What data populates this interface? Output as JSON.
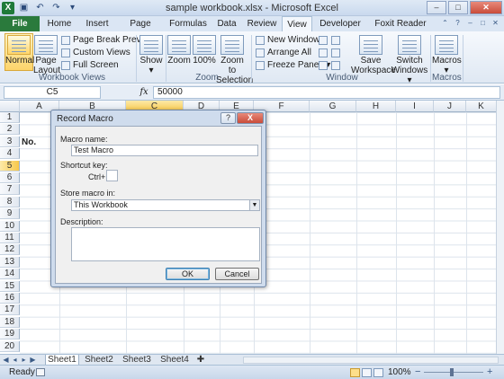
{
  "window": {
    "title": "sample workbook.xlsx - Microsoft Excel",
    "controls": {
      "minimize": "–",
      "maximize": "□",
      "close": "✕"
    },
    "app_icon": "X"
  },
  "ribbon_tabs": [
    "File",
    "Home",
    "Insert",
    "Page Layout",
    "Formulas",
    "Data",
    "Review",
    "View",
    "Developer",
    "Foxit Reader PDF"
  ],
  "active_tab": "View",
  "ribbon": {
    "workbook_views": {
      "label": "Workbook Views",
      "normal": "Normal",
      "page_layout_1": "Page",
      "page_layout_2": "Layout",
      "page_break_preview": "Page Break Preview",
      "custom_views": "Custom Views",
      "full_screen": "Full Screen"
    },
    "show": {
      "label": "Show"
    },
    "zoom": {
      "label": "Zoom",
      "zoom": "Zoom",
      "zoom_100": "100%",
      "zoom_to_selection_1": "Zoom to",
      "zoom_to_selection_2": "Selection"
    },
    "window": {
      "label": "Window",
      "new_window": "New Window",
      "arrange_all": "Arrange All",
      "freeze_panes": "Freeze Panes",
      "save_workspace_1": "Save",
      "save_workspace_2": "Workspace",
      "switch_windows_1": "Switch",
      "switch_windows_2": "Windows"
    },
    "macros": {
      "label": "Macros",
      "macros": "Macros"
    }
  },
  "formula_bar": {
    "name_box": "C5",
    "fx": "fx",
    "value": "50000"
  },
  "grid": {
    "columns": [
      "A",
      "B",
      "C",
      "D",
      "E",
      "F",
      "G",
      "H",
      "I",
      "J",
      "K"
    ],
    "selected_column": "C",
    "rows": [
      "1",
      "2",
      "3",
      "4",
      "5",
      "6",
      "7",
      "8",
      "9",
      "10",
      "11",
      "12",
      "13",
      "14",
      "15",
      "16",
      "17",
      "18",
      "19",
      "20"
    ],
    "selected_row": "5",
    "cell_a3": "No."
  },
  "sheets": [
    "Sheet1",
    "Sheet2",
    "Sheet3",
    "Sheet4"
  ],
  "active_sheet": "Sheet1",
  "status": {
    "ready": "Ready",
    "zoom": "100%",
    "minus": "−",
    "plus": "+"
  },
  "dialog": {
    "title": "Record Macro",
    "help": "?",
    "close": "X",
    "macro_name_label": "Macro name:",
    "macro_name_value": "Test Macro",
    "shortcut_label": "Shortcut key:",
    "ctrl_label": "Ctrl+",
    "shortcut_value": "",
    "store_label": "Store macro in:",
    "store_value": "This Workbook",
    "description_label": "Description:",
    "description_value": "",
    "ok": "OK",
    "cancel": "Cancel"
  }
}
